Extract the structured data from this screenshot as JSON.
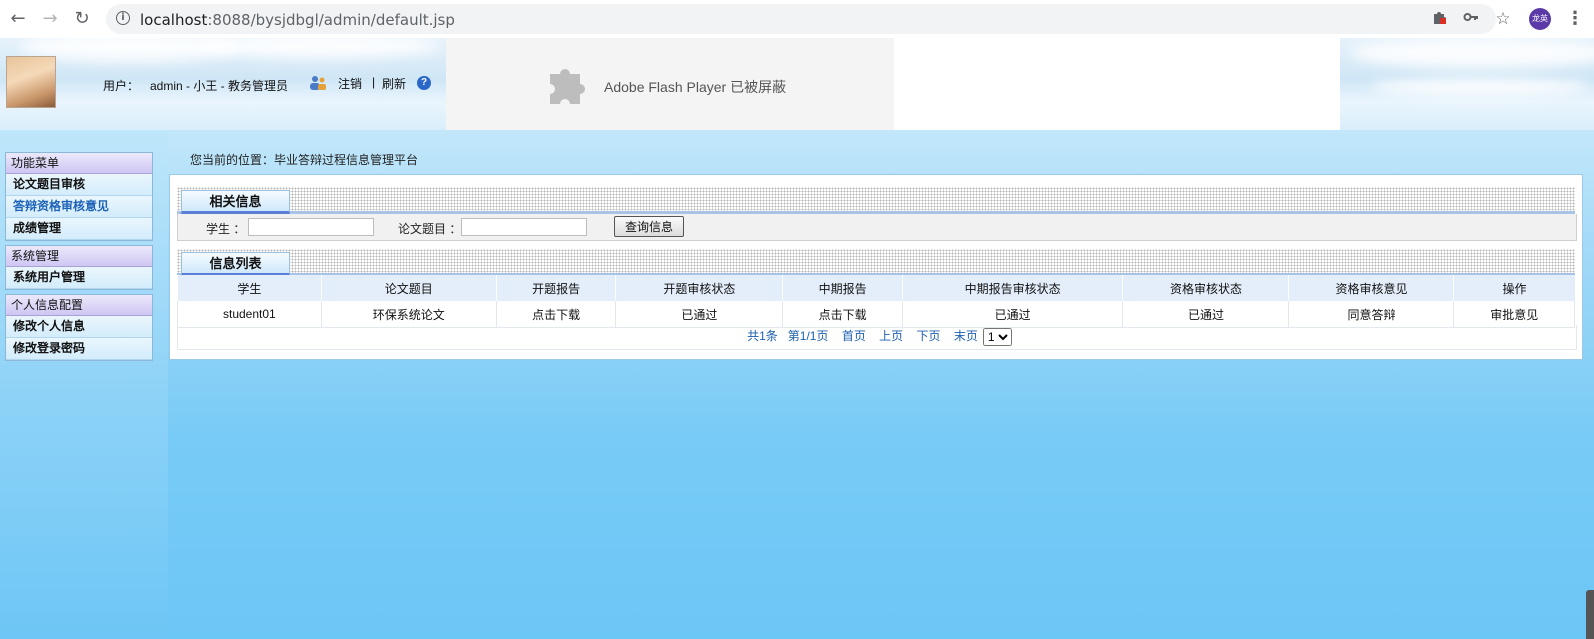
{
  "browser": {
    "url_host": "localhost",
    "url_rest": ":8088/bysjdbgl/admin/default.jsp",
    "profile_initials": "龙英"
  },
  "header": {
    "user_label": "用户：",
    "user_value": "admin - 小王 - 教务管理员",
    "logout_label": "注销",
    "separator": "|",
    "refresh_label": "刷新",
    "help_glyph": "?",
    "flash_text": "Adobe Flash Player 已被屏蔽"
  },
  "sidebar": {
    "groups": [
      {
        "title": "功能菜单",
        "items": [
          "论文题目审核",
          "答辩资格审核意见",
          "成绩管理"
        ]
      },
      {
        "title": "系统管理",
        "items": [
          "系统用户管理"
        ]
      },
      {
        "title": "个人信息配置",
        "items": [
          "修改个人信息",
          "修改登录密码"
        ]
      }
    ],
    "active_item": "答辩资格审核意见"
  },
  "main": {
    "location": "您当前的位置：毕业答辩过程信息管理平台",
    "related_title": "相关信息",
    "search": {
      "student_label": "学生 ：",
      "student_value": "",
      "topic_label": "论文题目 ：",
      "topic_value": "",
      "button_label": "查询信息"
    },
    "list_title": "信息列表",
    "table": {
      "headers": [
        "学生",
        "论文题目",
        "开题报告",
        "开题审核状态",
        "中期报告",
        "中期报告审核状态",
        "资格审核状态",
        "资格审核意见",
        "操作"
      ],
      "rows": [
        [
          "student01",
          "环保系统论文",
          "点击下载",
          "已通过",
          "点击下载",
          "已通过",
          "已通过",
          "同意答辩",
          "审批意见"
        ]
      ]
    },
    "pager": {
      "total": "共1条",
      "page": "第1/1页",
      "first": "首页",
      "prev": "上页",
      "next": "下页",
      "last": "末页",
      "selected": "1"
    }
  }
}
